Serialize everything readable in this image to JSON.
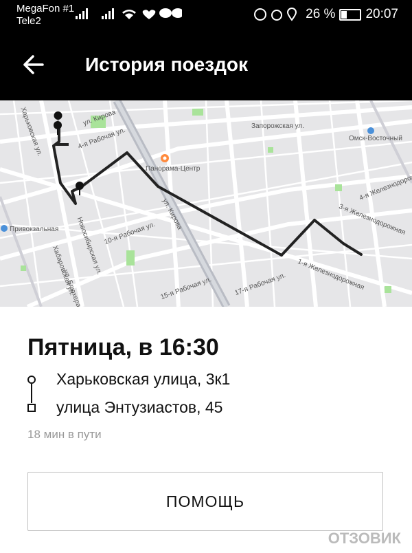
{
  "status_bar": {
    "carrier1": "MegaFon #1",
    "carrier2": "Tele2",
    "signal_icons": "📶📶",
    "battery_percent": "26 %",
    "battery_level": 0.26,
    "time": "20:07"
  },
  "header": {
    "back_icon": "arrow-left",
    "title": "История поездок"
  },
  "map": {
    "labels": [
      "Запорожская ул.",
      "Омск-Восточный",
      "Панорама-Центр",
      "ул. Кирова",
      "4-я Рабочая ул.",
      "10-я Рабочая ул.",
      "15-я Рабочая ул.",
      "17-я Рабочая ул.",
      "4-я Железнодорожная",
      "3-я Железнодорожная",
      "1-я Железнодорожная",
      "Хабаровская ул.",
      "Харьковская ул.",
      "Новосибирская ул.",
      "ул. Блюхера",
      "Привокзальная",
      "ул. Кирова"
    ]
  },
  "trip": {
    "day": "Пятница, в 16:30",
    "from": "Харьковская улица, 3к1",
    "to": "улица Энтузиастов, 45",
    "duration": "18 мин в пути",
    "help_label": "ПОМОЩЬ"
  },
  "watermark": "ОТЗОВИК",
  "colors": {
    "appbar": "#000000",
    "route": "#222222",
    "map_bg": "#e6e6e8",
    "park": "#a9e39a",
    "poi": "#ff8a3d"
  }
}
